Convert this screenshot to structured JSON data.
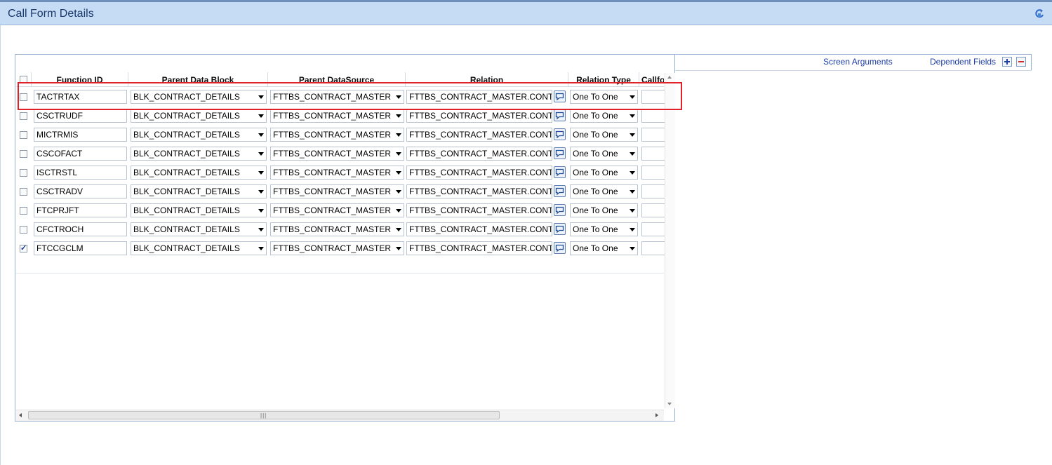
{
  "window": {
    "title": "Call Form Details",
    "exit_icon": "exit-icon"
  },
  "toolbar": {
    "screen_arguments": "Screen Arguments",
    "dependent_fields": "Dependent Fields",
    "add_icon": "plus-icon",
    "remove_icon": "minus-icon"
  },
  "columns": [
    "Function ID",
    "Parent Data Block",
    "Parent DataSource",
    "Relation",
    "Relation Type",
    "Callfo"
  ],
  "rows": [
    {
      "function_id": "TACTRTAX",
      "parent_block": "BLK_CONTRACT_DETAILS",
      "parent_source": "FTTBS_CONTRACT_MASTER",
      "relation": "FTTBS_CONTRACT_MASTER.CONT",
      "relation_type": "One To One",
      "checked": false
    },
    {
      "function_id": "CSCTRUDF",
      "parent_block": "BLK_CONTRACT_DETAILS",
      "parent_source": "FTTBS_CONTRACT_MASTER",
      "relation": "FTTBS_CONTRACT_MASTER.CONT",
      "relation_type": "One To One",
      "checked": false
    },
    {
      "function_id": "MICTRMIS",
      "parent_block": "BLK_CONTRACT_DETAILS",
      "parent_source": "FTTBS_CONTRACT_MASTER",
      "relation": "FTTBS_CONTRACT_MASTER.CONT",
      "relation_type": "One To One",
      "checked": false
    },
    {
      "function_id": "CSCOFACT",
      "parent_block": "BLK_CONTRACT_DETAILS",
      "parent_source": "FTTBS_CONTRACT_MASTER",
      "relation": "FTTBS_CONTRACT_MASTER.CONT",
      "relation_type": "One To One",
      "checked": false
    },
    {
      "function_id": "ISCTRSTL",
      "parent_block": "BLK_CONTRACT_DETAILS",
      "parent_source": "FTTBS_CONTRACT_MASTER",
      "relation": "FTTBS_CONTRACT_MASTER.CONT",
      "relation_type": "One To One",
      "checked": false
    },
    {
      "function_id": "CSCTRADV",
      "parent_block": "BLK_CONTRACT_DETAILS",
      "parent_source": "FTTBS_CONTRACT_MASTER",
      "relation": "FTTBS_CONTRACT_MASTER.CONT",
      "relation_type": "One To One",
      "checked": false
    },
    {
      "function_id": "FTCPRJFT",
      "parent_block": "BLK_CONTRACT_DETAILS",
      "parent_source": "FTTBS_CONTRACT_MASTER",
      "relation": "FTTBS_CONTRACT_MASTER.CONT",
      "relation_type": "One To One",
      "checked": false
    },
    {
      "function_id": "CFCTROCH",
      "parent_block": "BLK_CONTRACT_DETAILS",
      "parent_source": "FTTBS_CONTRACT_MASTER",
      "relation": "FTTBS_CONTRACT_MASTER.CONT",
      "relation_type": "One To One",
      "checked": false
    },
    {
      "function_id": "FTCCGCLM",
      "parent_block": "BLK_CONTRACT_DETAILS",
      "parent_source": "FTTBS_CONTRACT_MASTER",
      "relation": "FTTBS_CONTRACT_MASTER.CONT",
      "relation_type": "One To One",
      "checked": true
    }
  ],
  "colors": {
    "title_bar": "#c6dbf4",
    "link": "#1f3fa8",
    "highlight": "#e0202a"
  }
}
